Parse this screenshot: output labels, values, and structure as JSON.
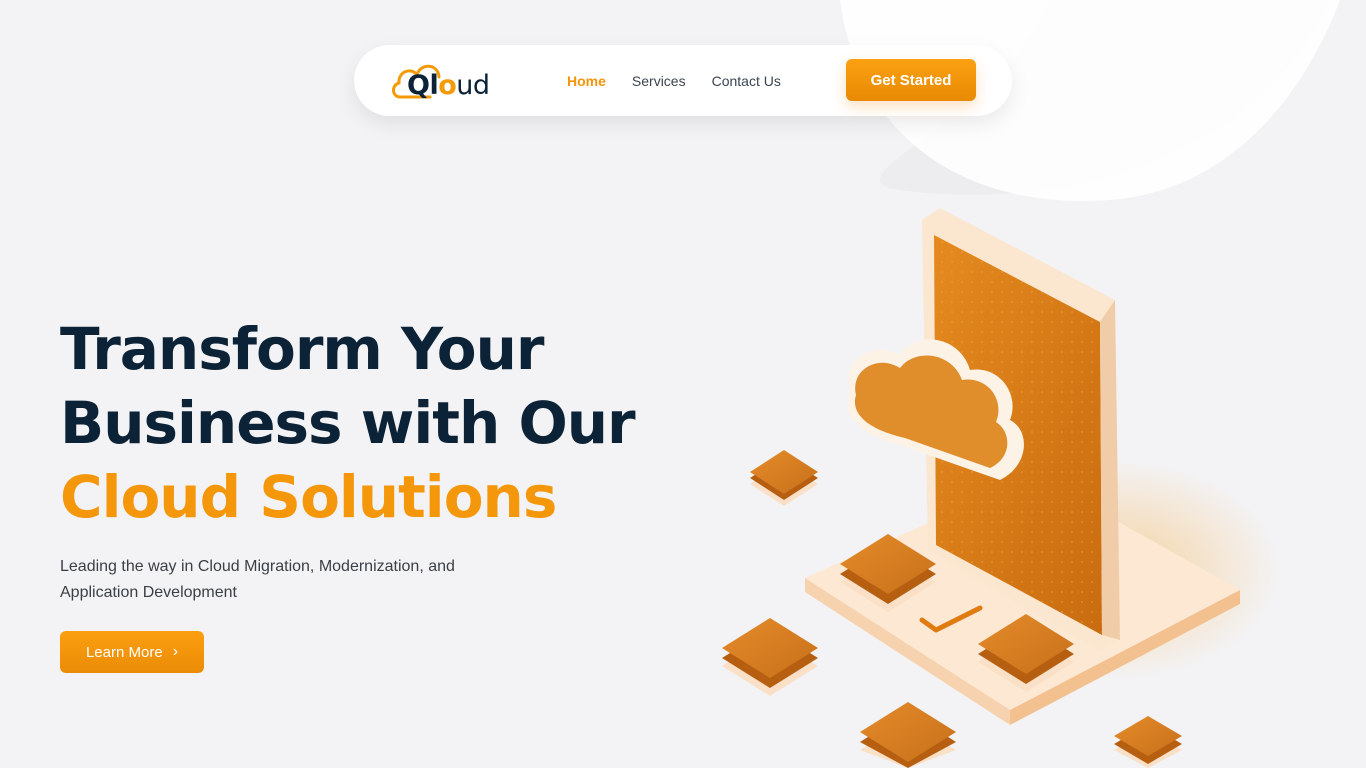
{
  "brand": {
    "logo_text_q": "Q",
    "logo_text_l": "l",
    "logo_text_o": "o",
    "logo_text_ud": "ud",
    "accent_color": "#f5970a",
    "dark_color": "#0c2236"
  },
  "nav": {
    "links": [
      {
        "label": "Home",
        "active": true
      },
      {
        "label": "Services",
        "active": false
      },
      {
        "label": "Contact Us",
        "active": false
      }
    ],
    "cta_label": "Get Started"
  },
  "hero": {
    "title_line1": "Transform Your",
    "title_line2": "Business with Our",
    "title_accent": "Cloud Solutions",
    "subtitle": "Leading the way in Cloud Migration, Modernization, and Application Development",
    "button_label": "Learn More",
    "button_icon": "chevron-right-icon"
  },
  "illustration": {
    "description_icons": [
      "phone-icon",
      "cloud-icon",
      "chip-icon",
      "checkmark-icon"
    ]
  }
}
